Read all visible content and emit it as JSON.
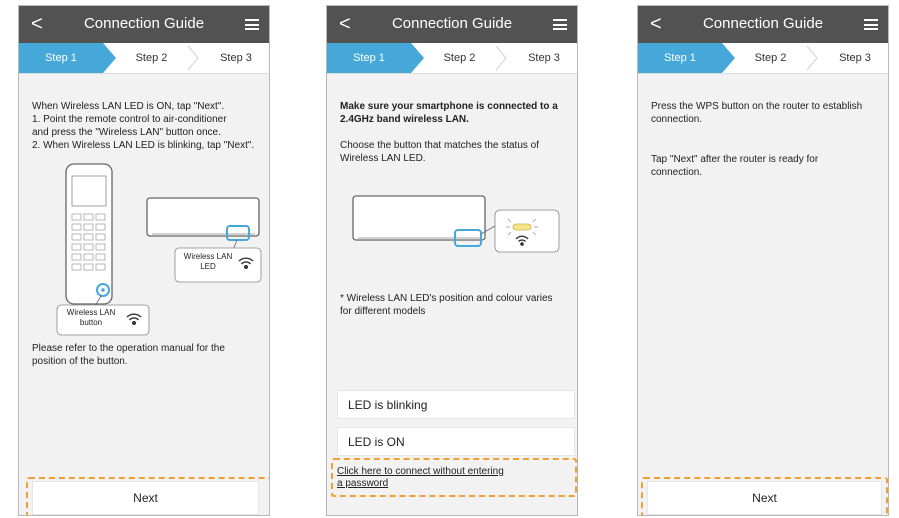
{
  "header": {
    "back": "<",
    "title": "Connection Guide"
  },
  "steps": [
    "Step 1",
    "Step 2",
    "Step 3"
  ],
  "panel1": {
    "instructions": [
      "When Wireless LAN LED is ON, tap \"Next\".",
      "1. Point the remote control to air-conditioner",
      "and press the \"Wireless LAN\" button once.",
      "2. When Wireless LAN LED is blinking, tap \"Next\"."
    ],
    "led_label_line1": "Wireless LAN",
    "led_label_line2": "LED",
    "button_label_line1": "Wireless LAN",
    "button_label_line2": "button",
    "refer_line1": "Please refer to the operation manual for the",
    "refer_line2": "position of the button.",
    "next": "Next"
  },
  "panel2": {
    "bold_line1": "Make sure your smartphone is connected to a",
    "bold_line2": "2.4GHz band wireless LAN.",
    "choose_line1": "Choose the button that matches the status of",
    "choose_line2": "Wireless LAN LED.",
    "note_line1": "* Wireless LAN LED's position and colour varies",
    "note_line2": "for different models",
    "blinking": "LED is blinking",
    "on": "LED is ON",
    "link_line1": "Click here to connect without entering",
    "link_line2": "a password"
  },
  "panel3": {
    "line1": "Press the WPS button on the router to establish",
    "line2": "connection.",
    "line3": "Tap \"Next\" after the router is ready for",
    "line4": "connection.",
    "next": "Next"
  },
  "colors": {
    "header": "#525252",
    "step_active": "#45a8d8",
    "highlight": "#f0a030"
  },
  "icons": [
    "back-chevron-icon",
    "hamburger-menu-icon",
    "wifi-icon",
    "remote-control-icon",
    "air-conditioner-icon"
  ]
}
